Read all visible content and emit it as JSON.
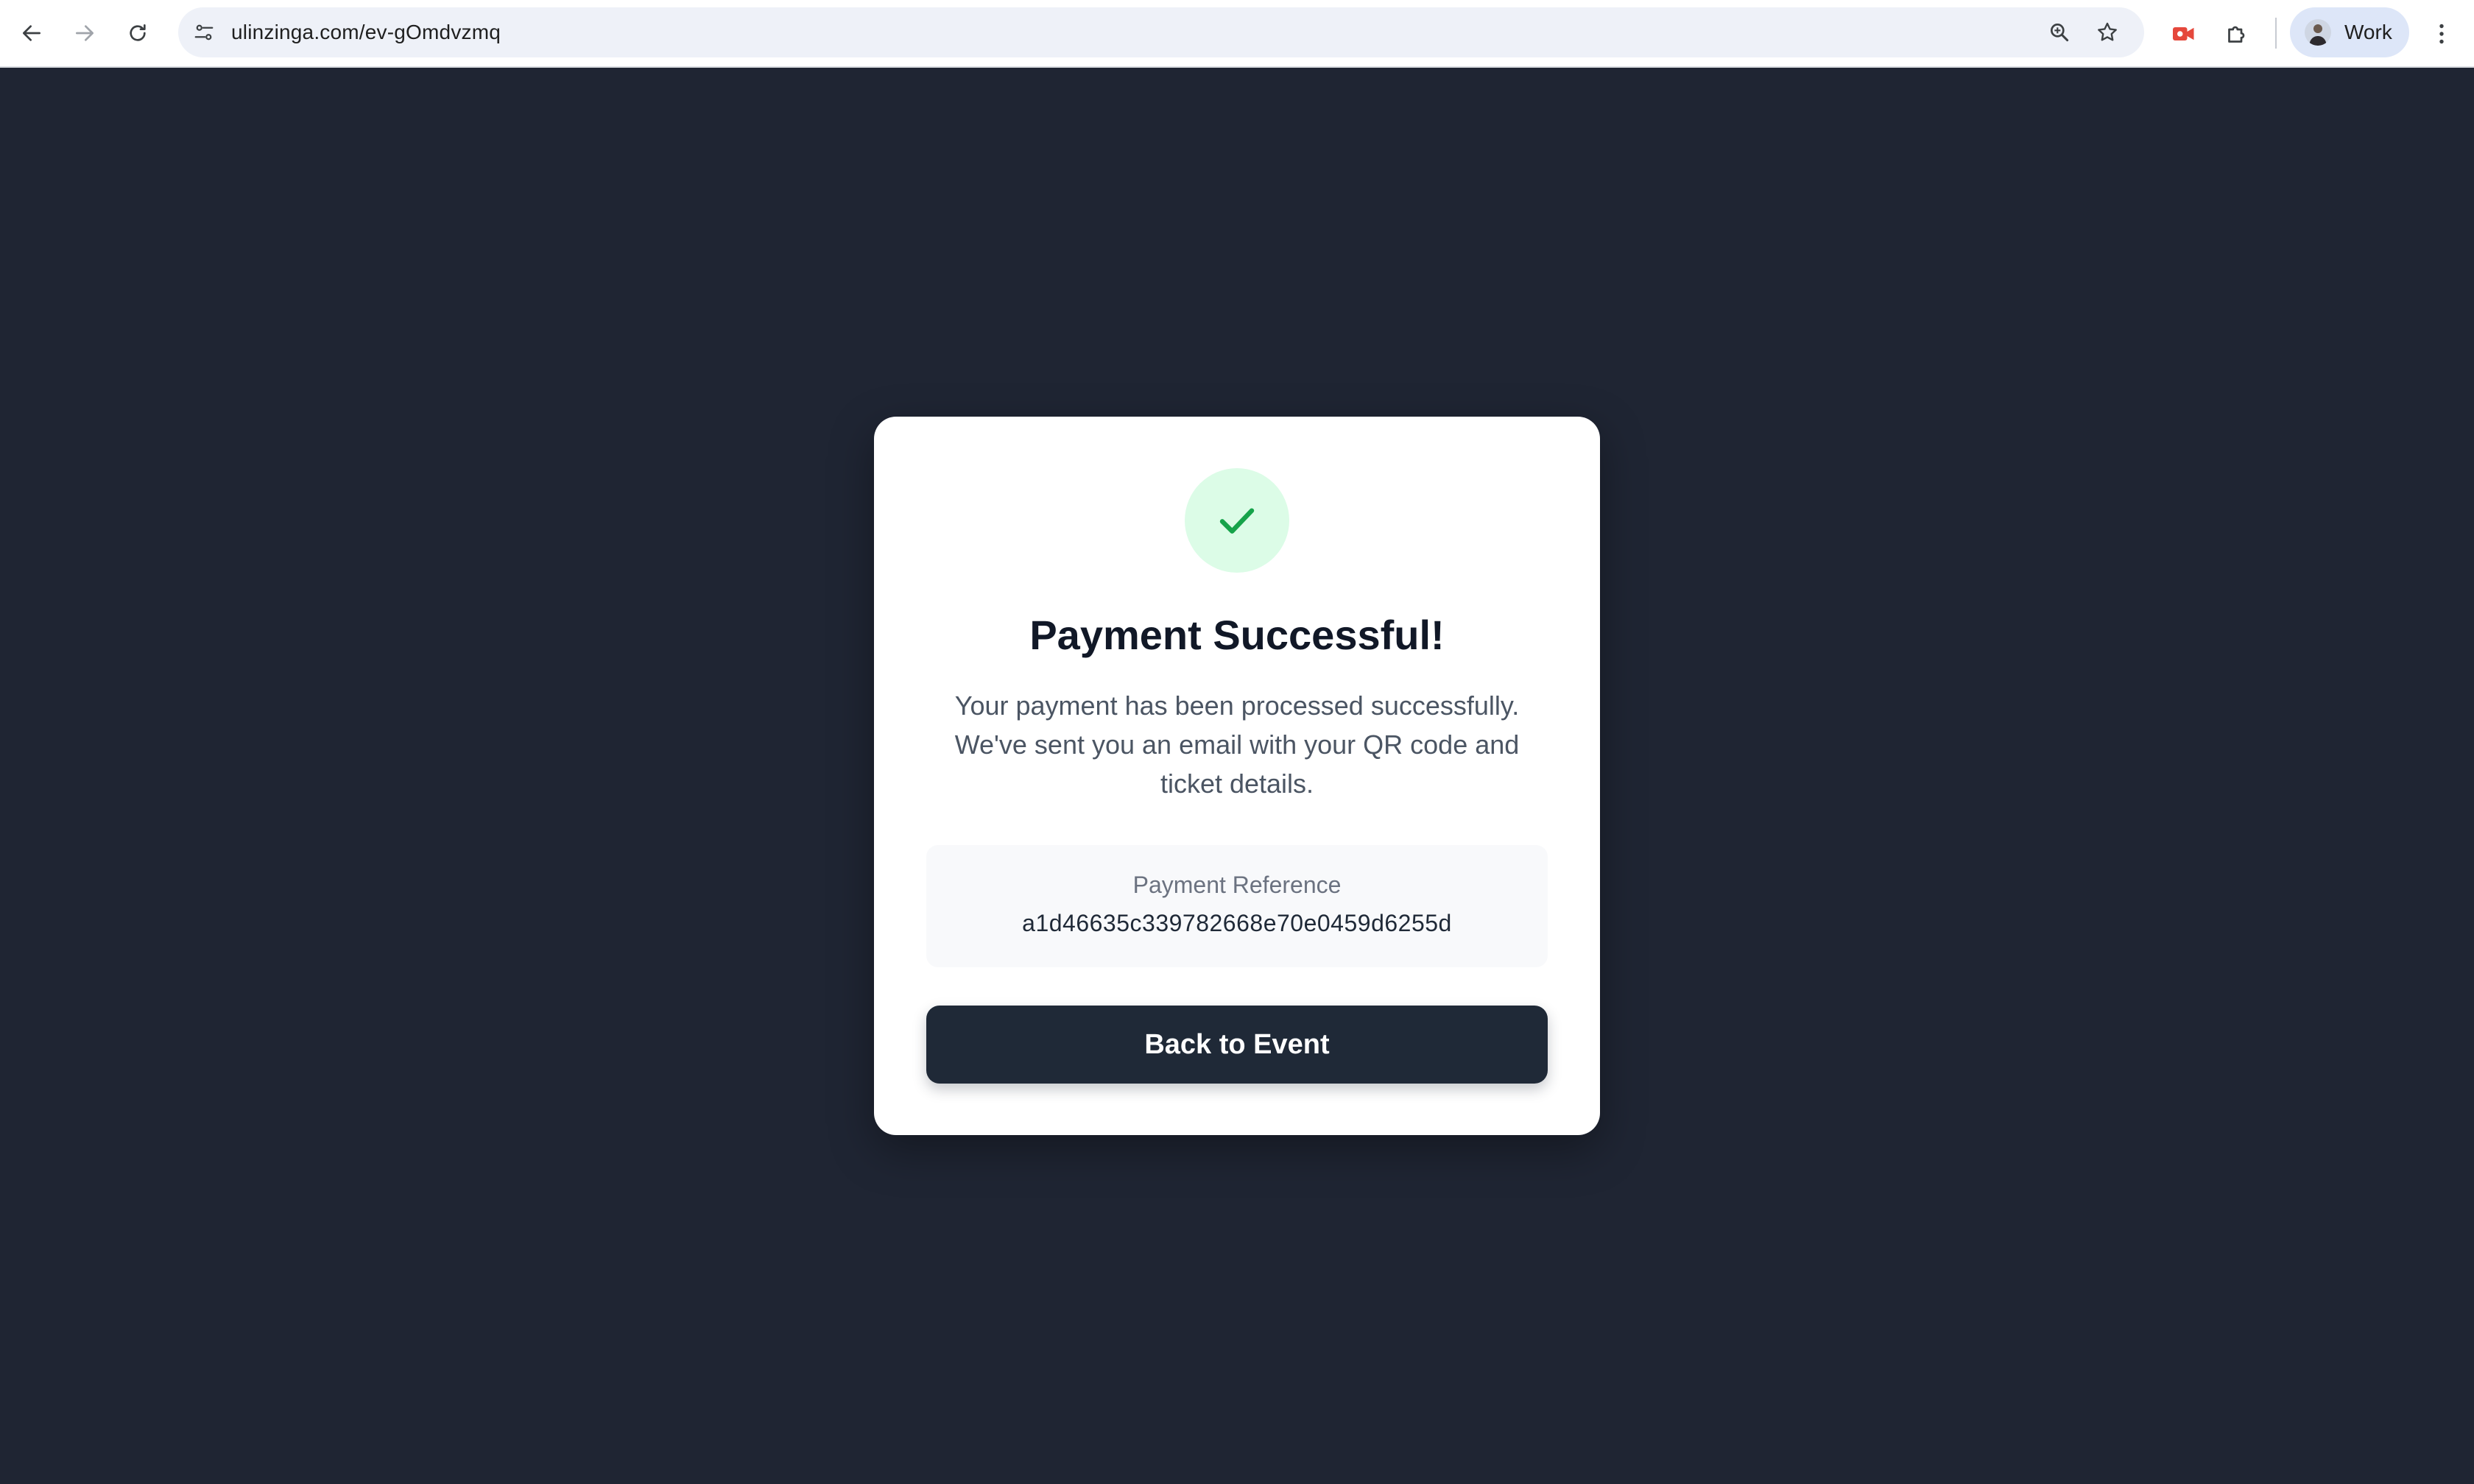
{
  "browser": {
    "url": "ulinzinga.com/ev-gOmdvzmq",
    "profile_label": "Work",
    "icons": {
      "back": "back-arrow-icon",
      "forward": "forward-arrow-icon",
      "reload": "reload-icon",
      "site_info": "site-settings-icon",
      "zoom": "zoom-icon",
      "bookmark": "star-icon",
      "extension_recorder": "video-recorder-icon",
      "extensions": "puzzle-icon",
      "menu": "kebab-menu-icon"
    }
  },
  "card": {
    "icon": "check-icon",
    "title": "Payment Successful!",
    "message_lines": [
      "Your payment has been processed successfully.",
      "We've sent you an email with your QR code and",
      "ticket details."
    ],
    "reference": {
      "label": "Payment Reference",
      "value": "a1d46635c339782668e70e0459d6255d"
    },
    "button_label": "Back to Event"
  },
  "colors": {
    "page_background": "#1f2533",
    "card_background": "#ffffff",
    "success_circle": "#dcfce7",
    "success_check": "#16a34a",
    "button": "#1f2937",
    "title_text": "#111827"
  }
}
